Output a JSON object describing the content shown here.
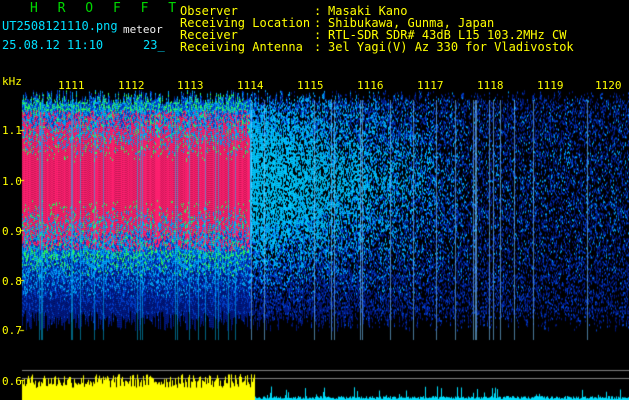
{
  "header": {
    "station": "H R O F F T",
    "filename": "UT2508121110.png",
    "tag": "meteor",
    "datetime": "25.08.12 11:10",
    "count": "23_",
    "fields": [
      {
        "label": "Observer",
        "sep": ":",
        "value": "Masaki Kano"
      },
      {
        "label": "Receiving Location",
        "sep": ":",
        "value": "Shibukawa, Gunma, Japan"
      },
      {
        "label": "Receiver",
        "sep": ":",
        "value": "RTL-SDR SDR# 43dB L15 103.2MHz CW"
      },
      {
        "label": "Receiving Antenna",
        "sep": ":",
        "value": "3el Yagi(V) Az 330 for Vladivostok"
      }
    ]
  },
  "axis": {
    "y_unit": "kHz",
    "y_ticks": [
      "1.1",
      "1.0",
      "0.9",
      "0.8",
      "0.7",
      "0.6"
    ],
    "x_ticks": [
      "1111",
      "1112",
      "1113",
      "1114",
      "1115",
      "1116",
      "1117",
      "1118",
      "1119",
      "1120"
    ]
  },
  "colors": {
    "background": "#000000",
    "label": "#ffff00",
    "signal_strong": "#ff2070",
    "signal_mid": "#00c8ff",
    "signal_low": "#0018a0",
    "power_bar": "#ffff00",
    "power_bar_tail": "#00e0ff"
  }
}
